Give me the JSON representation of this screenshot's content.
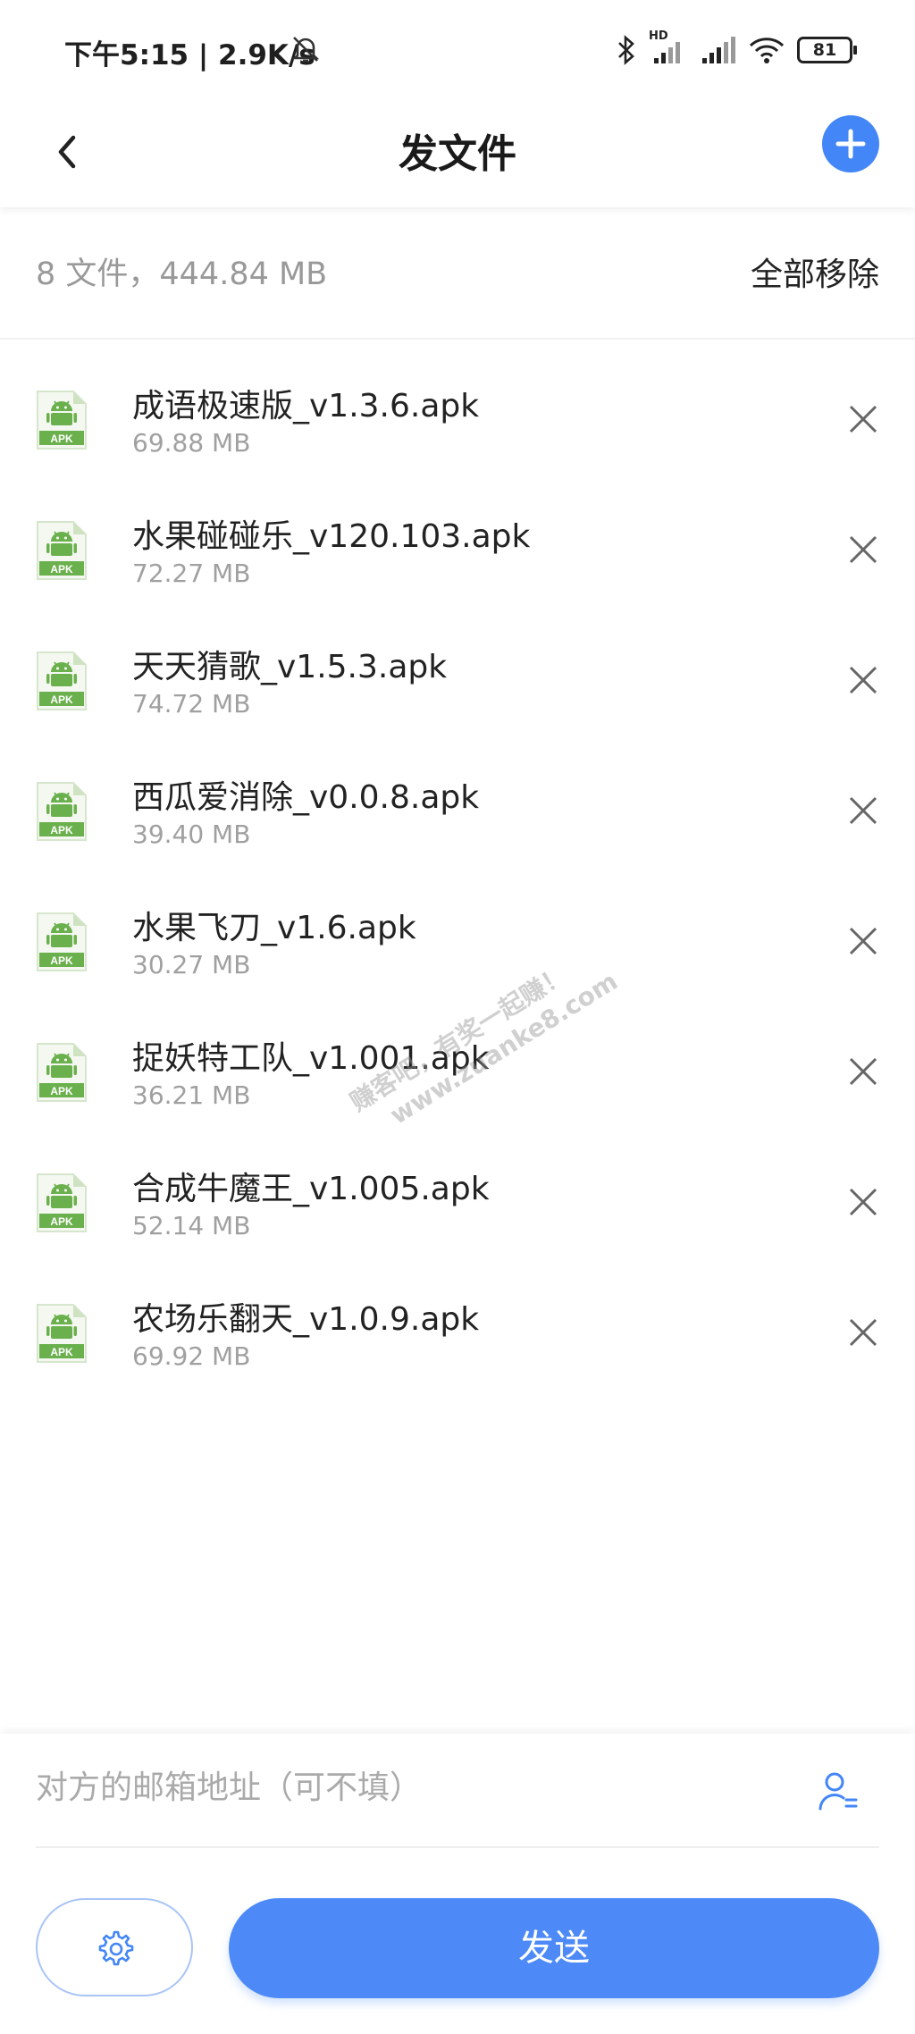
{
  "status_bar": {
    "time_speed": "下午5:15 | 2.9K/s",
    "battery": "81",
    "network_label": "HD"
  },
  "header": {
    "title": "发文件"
  },
  "summary": {
    "count_size": "8 文件，444.84 MB",
    "remove_all_label": "全部移除"
  },
  "files": [
    {
      "name": "成语极速版_v1.3.6.apk",
      "size": "69.88 MB",
      "icon": "apk-android-icon"
    },
    {
      "name": "水果碰碰乐_v120.103.apk",
      "size": "72.27 MB",
      "icon": "apk-android-icon"
    },
    {
      "name": "天天猜歌_v1.5.3.apk",
      "size": "74.72 MB",
      "icon": "apk-android-icon"
    },
    {
      "name": "西瓜爱消除_v0.0.8.apk",
      "size": "39.40 MB",
      "icon": "apk-android-icon"
    },
    {
      "name": "水果飞刀_v1.6.apk",
      "size": "30.27 MB",
      "icon": "apk-android-icon"
    },
    {
      "name": "捉妖特工队_v1.001.apk",
      "size": "36.21 MB",
      "icon": "apk-android-icon"
    },
    {
      "name": "合成牛魔王_v1.005.apk",
      "size": "52.14 MB",
      "icon": "apk-android-icon"
    },
    {
      "name": "农场乐翻天_v1.0.9.apk",
      "size": "69.92 MB",
      "icon": "apk-android-icon"
    }
  ],
  "watermark": {
    "line1": "赚客吧，有奖一起赚！",
    "line2": "www.zuanke8.com"
  },
  "bottom": {
    "email_placeholder": "对方的邮箱地址（可不填）",
    "email_value": "",
    "send_label": "发送"
  },
  "colors": {
    "accent": "#4386f7",
    "apk_green": "#6ab04c"
  },
  "apk_label": "APK"
}
